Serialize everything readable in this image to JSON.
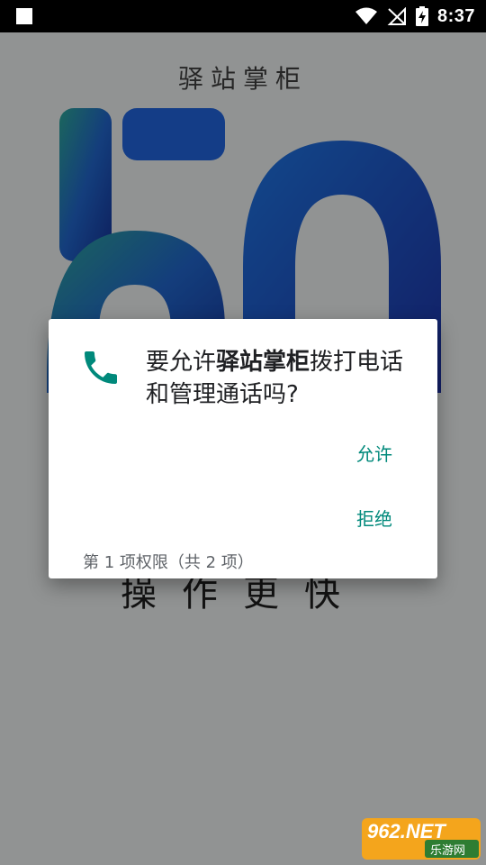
{
  "status_bar": {
    "time": "8:37"
  },
  "background": {
    "title": "驿站掌柜",
    "number": "50",
    "bottom_text": "操作更快"
  },
  "dialog": {
    "message_prefix": "要允许",
    "app_name": "驿站掌柜",
    "message_suffix": "拨打电话和管理通话吗?",
    "allow_label": "允许",
    "deny_label": "拒绝",
    "footer": "第 1 项权限（共 2 项）",
    "icon": "phone-icon",
    "accent_color": "#00897b"
  },
  "watermark": {
    "logo_text": "962.NET",
    "sub_text": "乐游网"
  }
}
